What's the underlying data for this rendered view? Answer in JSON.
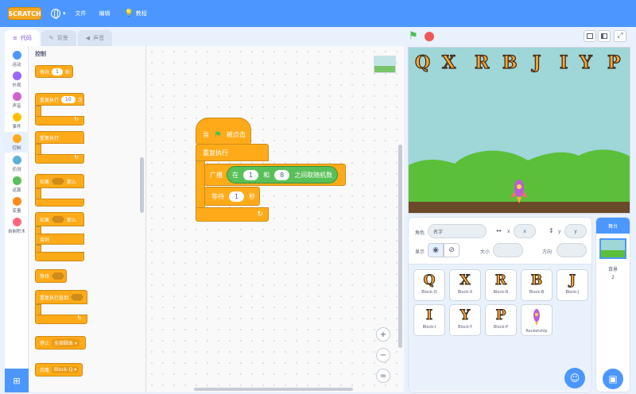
{
  "menubar": {
    "logo": "SCRATCH",
    "file": "文件",
    "edit": "编辑",
    "tutorials": "教程"
  },
  "tabs": [
    {
      "label": "代码"
    },
    {
      "label": "背景"
    },
    {
      "label": "声音"
    }
  ],
  "categories": [
    {
      "label": "运动",
      "color": "#4c97ff"
    },
    {
      "label": "外观",
      "color": "#9966ff"
    },
    {
      "label": "声音",
      "color": "#cf63cf"
    },
    {
      "label": "事件",
      "color": "#ffbf00"
    },
    {
      "label": "控制",
      "color": "#ffab19"
    },
    {
      "label": "侦测",
      "color": "#5cb1d6"
    },
    {
      "label": "运算",
      "color": "#59c059"
    },
    {
      "label": "变量",
      "color": "#ff8c1a"
    },
    {
      "label": "自制积木",
      "color": "#ff6680"
    }
  ],
  "palette": {
    "title": "控制",
    "wait_prefix": "等待",
    "wait_value": "1",
    "wait_suffix": "秒",
    "repeat_prefix": "重复执行",
    "repeat_value": "10",
    "repeat_suffix": "次",
    "forever": "重复执行",
    "if_prefix": "如果",
    "if_suffix": "那么",
    "if2_prefix": "如果",
    "if2_suffix": "那么",
    "else": "否则",
    "wait_until": "等待",
    "repeat_until": "重复执行直到",
    "stop_label": "停止",
    "stop_value": "全部脚本",
    "clone_label": "克隆",
    "clone_value": "Block-Q"
  },
  "script": {
    "hat_prefix": "当",
    "hat_suffix": "被点击",
    "forever": "重复执行",
    "broadcast": "广播",
    "pick_in": "在",
    "pick_from": "1",
    "pick_and": "和",
    "pick_to": "8",
    "pick_suffix": "之间取随机数",
    "wait_prefix": "等待",
    "wait_value": "1",
    "wait_suffix": "秒"
  },
  "stage_letters": [
    "Q",
    "X",
    "R",
    "B",
    "J",
    "I",
    "Y",
    "P"
  ],
  "sprite_info": {
    "sprite_label": "角色",
    "sprite_name": "名字",
    "x_label": "x",
    "x_value": "x",
    "y_label": "y",
    "y_value": "y",
    "show_label": "显示",
    "size_label": "大小",
    "direction_label": "方向"
  },
  "sprites": [
    {
      "glyph": "Q",
      "name": "Block-Q"
    },
    {
      "glyph": "X",
      "name": "Block-X"
    },
    {
      "glyph": "R",
      "name": "Block-R"
    },
    {
      "glyph": "B",
      "name": "Block-B"
    },
    {
      "glyph": "J",
      "name": "Block-J"
    },
    {
      "glyph": "I",
      "name": "Block-I"
    },
    {
      "glyph": "Y",
      "name": "Block-Y"
    },
    {
      "glyph": "P",
      "name": "Block-P"
    },
    {
      "glyph": "",
      "name": "Rocketship"
    }
  ],
  "stage_panel": {
    "title": "舞台",
    "backdrop_label": "背景",
    "backdrop_count": "2"
  }
}
